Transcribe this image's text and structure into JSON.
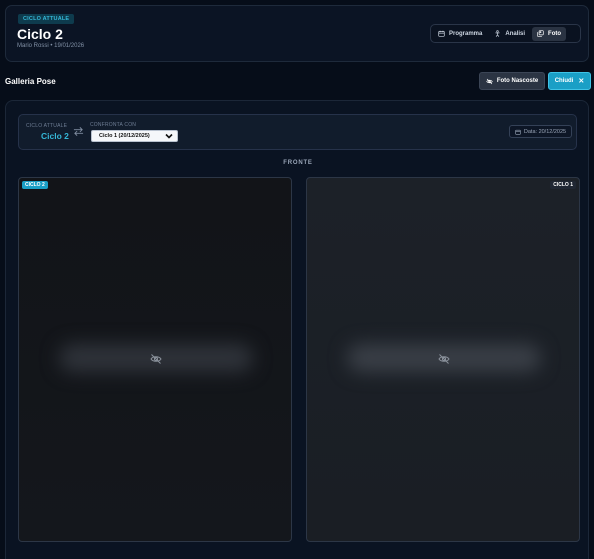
{
  "header": {
    "badge": "CICLO ATTUALE",
    "title": "Ciclo 2",
    "subtitle": "Mario Rossi • 19/01/2026",
    "tabs": [
      {
        "label": "Programma",
        "icon": "calendar-icon"
      },
      {
        "label": "Analisi",
        "icon": "body-icon"
      },
      {
        "label": "Foto",
        "icon": "photos-icon",
        "active": true
      }
    ]
  },
  "gallery": {
    "title": "Galleria Pose",
    "hidden_button": "Foto Nascoste",
    "close_button": "Chiudi",
    "close_glyph": "✕"
  },
  "compare": {
    "current_label": "CICLO ATTUALE",
    "current_value": "Ciclo 2",
    "compare_label": "CONFRONTA CON",
    "compare_value": "Ciclo 1 (20/12/2025)",
    "date": "Data: 20/12/2025"
  },
  "section": "FRONTE",
  "photos": {
    "left_badge": "CICLO 2",
    "right_badge": "CICLO 1"
  },
  "colors": {
    "accent": "#1a9fc6",
    "background": "#060d19"
  }
}
